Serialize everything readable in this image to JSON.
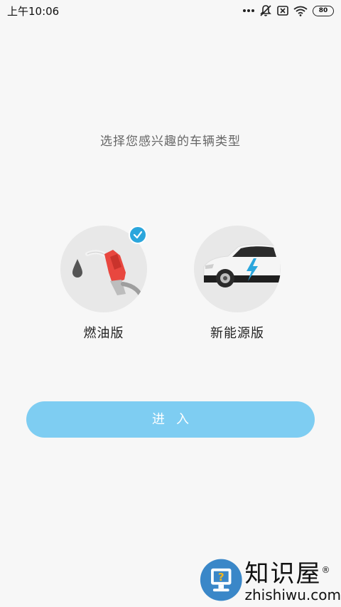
{
  "status_bar": {
    "time": "上午10:06",
    "battery": "80",
    "icons": [
      "more-dots-icon",
      "mute-icon",
      "sim-off-icon",
      "wifi-icon",
      "battery-icon"
    ]
  },
  "prompt": "选择您感兴趣的车辆类型",
  "options": [
    {
      "label": "燃油版",
      "icon": "fuel-pump-icon",
      "selected": true
    },
    {
      "label": "新能源版",
      "icon": "electric-car-icon",
      "selected": false
    }
  ],
  "enter_button": {
    "label": "进入"
  },
  "colors": {
    "accent": "#2ba6dc",
    "button": "#7ecdf2",
    "background": "#f7f7f7",
    "circle": "#e8e8e8",
    "fuel_red": "#e8473f"
  },
  "watermark": {
    "cn": "知识屋",
    "en": "zhishiwu.com",
    "mark": "®"
  }
}
